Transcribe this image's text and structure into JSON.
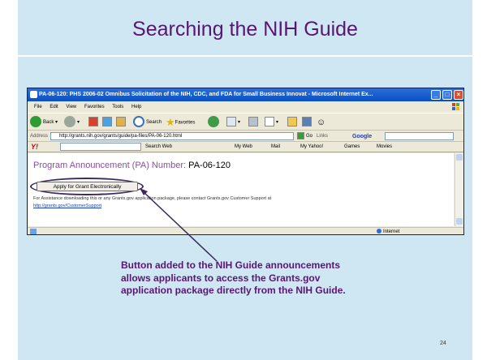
{
  "slide": {
    "title": "Searching the NIH Guide",
    "page_number": "24",
    "callout": "Button added to the NIH Guide announcements allows applicants to access the Grants.gov application package directly from the NIH Guide.",
    "colors": {
      "background": "#cfe7f3",
      "title": "#5a1573",
      "callout": "#5a1573"
    }
  },
  "browser": {
    "window_title": "PA-06-120: PHS 2006-02 Omnibus Solicitation of the NIH, CDC, and FDA for Small Business Innovat - Microsoft Internet Ex...",
    "menu": [
      "File",
      "Edit",
      "View",
      "Favorites",
      "Tools",
      "Help"
    ],
    "toolbar": {
      "back": "Back",
      "search": "Search",
      "favorites": "Favorites"
    },
    "address_label": "Address",
    "address_value": "http://grants.nih.gov/grants/guide/pa-files/PA-06-120.html",
    "go": "Go",
    "links": "Links",
    "google": "Google",
    "yahoo": {
      "logo": "Y!",
      "search_web": "Search Web",
      "my_web": "My Web",
      "mail": "Mail",
      "my_yahoo": "My Yahoo!",
      "games": "Games",
      "movies": "Movies"
    },
    "status_zone": "Internet"
  },
  "page": {
    "heading_prefix": "Program Announcement (PA) Number:",
    "heading_number": "PA-06-120",
    "apply_button": "Apply for Grant Electronically",
    "notice": "For Assistance downloading this or any Grants.gov application package, please contact Grants.gov Customer Support at",
    "support_link": "http://grants.gov/CustomerSupport"
  }
}
